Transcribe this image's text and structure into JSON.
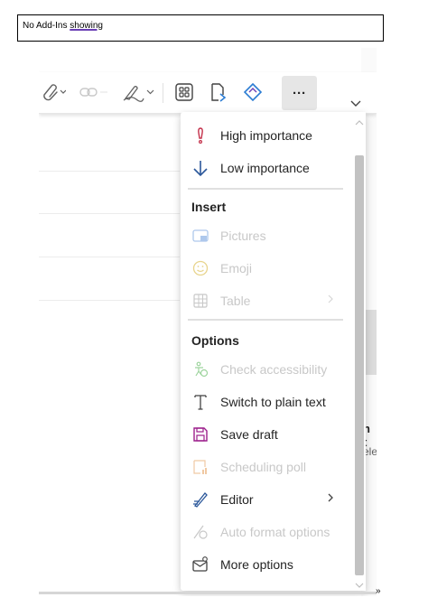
{
  "caption": {
    "prefix": "No Add-Ins ",
    "underlined": "showing"
  },
  "toolbar": {
    "icons": [
      "attach-icon",
      "link-icon",
      "signature-icon",
      "apps-icon",
      "loop-icon",
      "viva-icon",
      "more-options-icon"
    ],
    "more_label": "···",
    "accent": "#5b5fc7"
  },
  "menu": {
    "priority": [
      {
        "label": "High importance",
        "icon": "exclamation-icon",
        "icon_color": "#c4314b",
        "disabled": false
      },
      {
        "label": "Low importance",
        "icon": "arrow-down-icon",
        "icon_color": "#2b579a",
        "disabled": false
      }
    ],
    "insert_title": "Insert",
    "insert": [
      {
        "label": "Pictures",
        "icon": "picture-icon",
        "disabled": true
      },
      {
        "label": "Emoji",
        "icon": "emoji-icon",
        "disabled": true
      },
      {
        "label": "Table",
        "icon": "table-icon",
        "disabled": true,
        "submenu": true
      }
    ],
    "options_title": "Options",
    "options": [
      {
        "label": "Check accessibility",
        "icon": "accessibility-icon",
        "disabled": true
      },
      {
        "label": "Switch to plain text",
        "icon": "text-icon",
        "disabled": false
      },
      {
        "label": "Save draft",
        "icon": "save-icon",
        "disabled": false
      },
      {
        "label": "Scheduling poll",
        "icon": "poll-icon",
        "disabled": true
      },
      {
        "label": "Editor",
        "icon": "editor-icon",
        "disabled": false,
        "submenu": true
      },
      {
        "label": "Auto format options",
        "icon": "auto-format-icon",
        "disabled": true
      },
      {
        "label": "More options",
        "icon": "mail-settings-icon",
        "disabled": false
      }
    ]
  },
  "peek": {
    "text1": "n t",
    "text2": "ele"
  },
  "footer_mark": "»"
}
